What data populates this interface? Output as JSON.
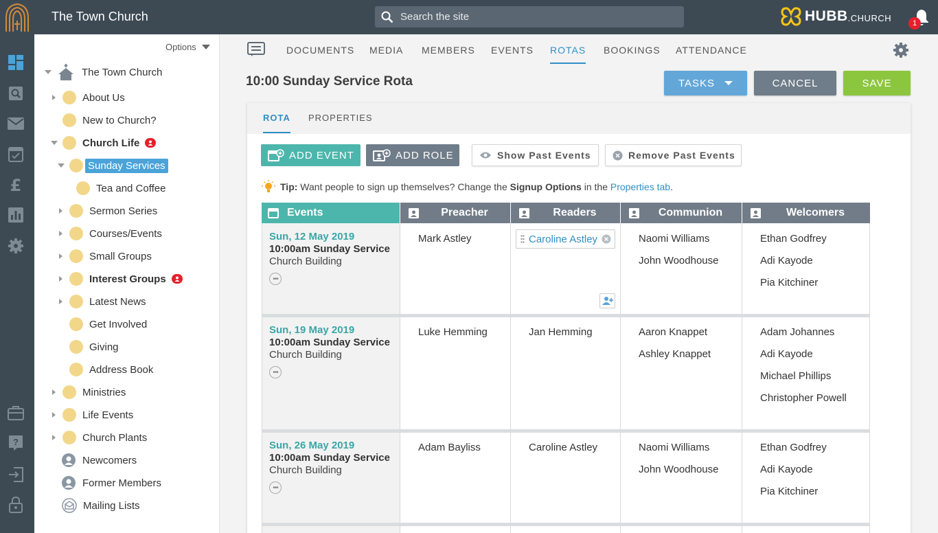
{
  "app": {
    "site_title": "The Town Church",
    "search_placeholder": "Search the site",
    "brand_main": "HUBB",
    "brand_sub": ".CHURCH",
    "notification_count": "1"
  },
  "tree": {
    "options_label": "Options",
    "root": "The Town Church",
    "items": [
      {
        "label": "About Us"
      },
      {
        "label": "New to Church?"
      },
      {
        "label": "Church Life"
      },
      {
        "label": "Sunday Services"
      },
      {
        "label": "Tea and Coffee"
      },
      {
        "label": "Sermon Series"
      },
      {
        "label": "Courses/Events"
      },
      {
        "label": "Small Groups"
      },
      {
        "label": "Interest Groups"
      },
      {
        "label": "Latest News"
      },
      {
        "label": "Get Involved"
      },
      {
        "label": "Giving"
      },
      {
        "label": "Address Book"
      },
      {
        "label": "Ministries"
      },
      {
        "label": "Life Events"
      },
      {
        "label": "Church Plants"
      },
      {
        "label": "Newcomers"
      },
      {
        "label": "Former Members"
      },
      {
        "label": "Mailing Lists"
      }
    ]
  },
  "nav": {
    "tabs": [
      "DOCUMENTS",
      "MEDIA",
      "MEMBERS",
      "EVENTS",
      "ROTAS",
      "BOOKINGS",
      "ATTENDANCE"
    ],
    "active": "ROTAS"
  },
  "page": {
    "title": "10:00 Sunday Service Rota",
    "tasks_label": "TASKS",
    "cancel_label": "CANCEL",
    "save_label": "SAVE"
  },
  "card": {
    "tabs": [
      "ROTA",
      "PROPERTIES"
    ],
    "add_event": "ADD EVENT",
    "add_role": "ADD ROLE",
    "show_past": "Show Past Events",
    "remove_past": "Remove Past Events",
    "tip_bold": "Tip:",
    "tip_text": "Want people to sign up themselves? Change the",
    "tip_signup": "Signup Options",
    "tip_in": "in the",
    "tip_link": "Properties tab",
    "tip_end": "."
  },
  "table": {
    "headers": [
      "Events",
      "Preacher",
      "Readers",
      "Communion",
      "Welcomers"
    ],
    "rows": [
      {
        "date": "Sun, 12 May 2019",
        "name": "10:00am Sunday Service",
        "location": "Church Building",
        "preacher": [
          "Mark Astley"
        ],
        "readers": [
          "Caroline Astley"
        ],
        "communion": [
          "Naomi Williams",
          "John Woodhouse"
        ],
        "welcomers": [
          "Ethan Godfrey",
          "Adi Kayode",
          "Pia Kitchiner"
        ]
      },
      {
        "date": "Sun, 19 May 2019",
        "name": "10:00am Sunday Service",
        "location": "Church Building",
        "preacher": [
          "Luke Hemming"
        ],
        "readers": [
          "Jan Hemming"
        ],
        "communion": [
          "Aaron Knappet",
          "Ashley Knappet"
        ],
        "welcomers": [
          "Adam Johannes",
          "Adi Kayode",
          "Michael Phillips",
          "Christopher Powell"
        ]
      },
      {
        "date": "Sun, 26 May 2019",
        "name": "10:00am Sunday Service",
        "location": "Church Building",
        "preacher": [
          "Adam Bayliss"
        ],
        "readers": [
          "Caroline Astley"
        ],
        "communion": [
          "Naomi Williams",
          "John Woodhouse"
        ],
        "welcomers": [
          "Ethan Godfrey",
          "Adi Kayode",
          "Pia Kitchiner"
        ]
      }
    ]
  },
  "colors": {
    "topbar": "#3d4a54",
    "accent_blue": "#2f8fc6",
    "teal": "#4db6ac",
    "save_green": "#8cc63f",
    "header_gray": "#717c88"
  }
}
